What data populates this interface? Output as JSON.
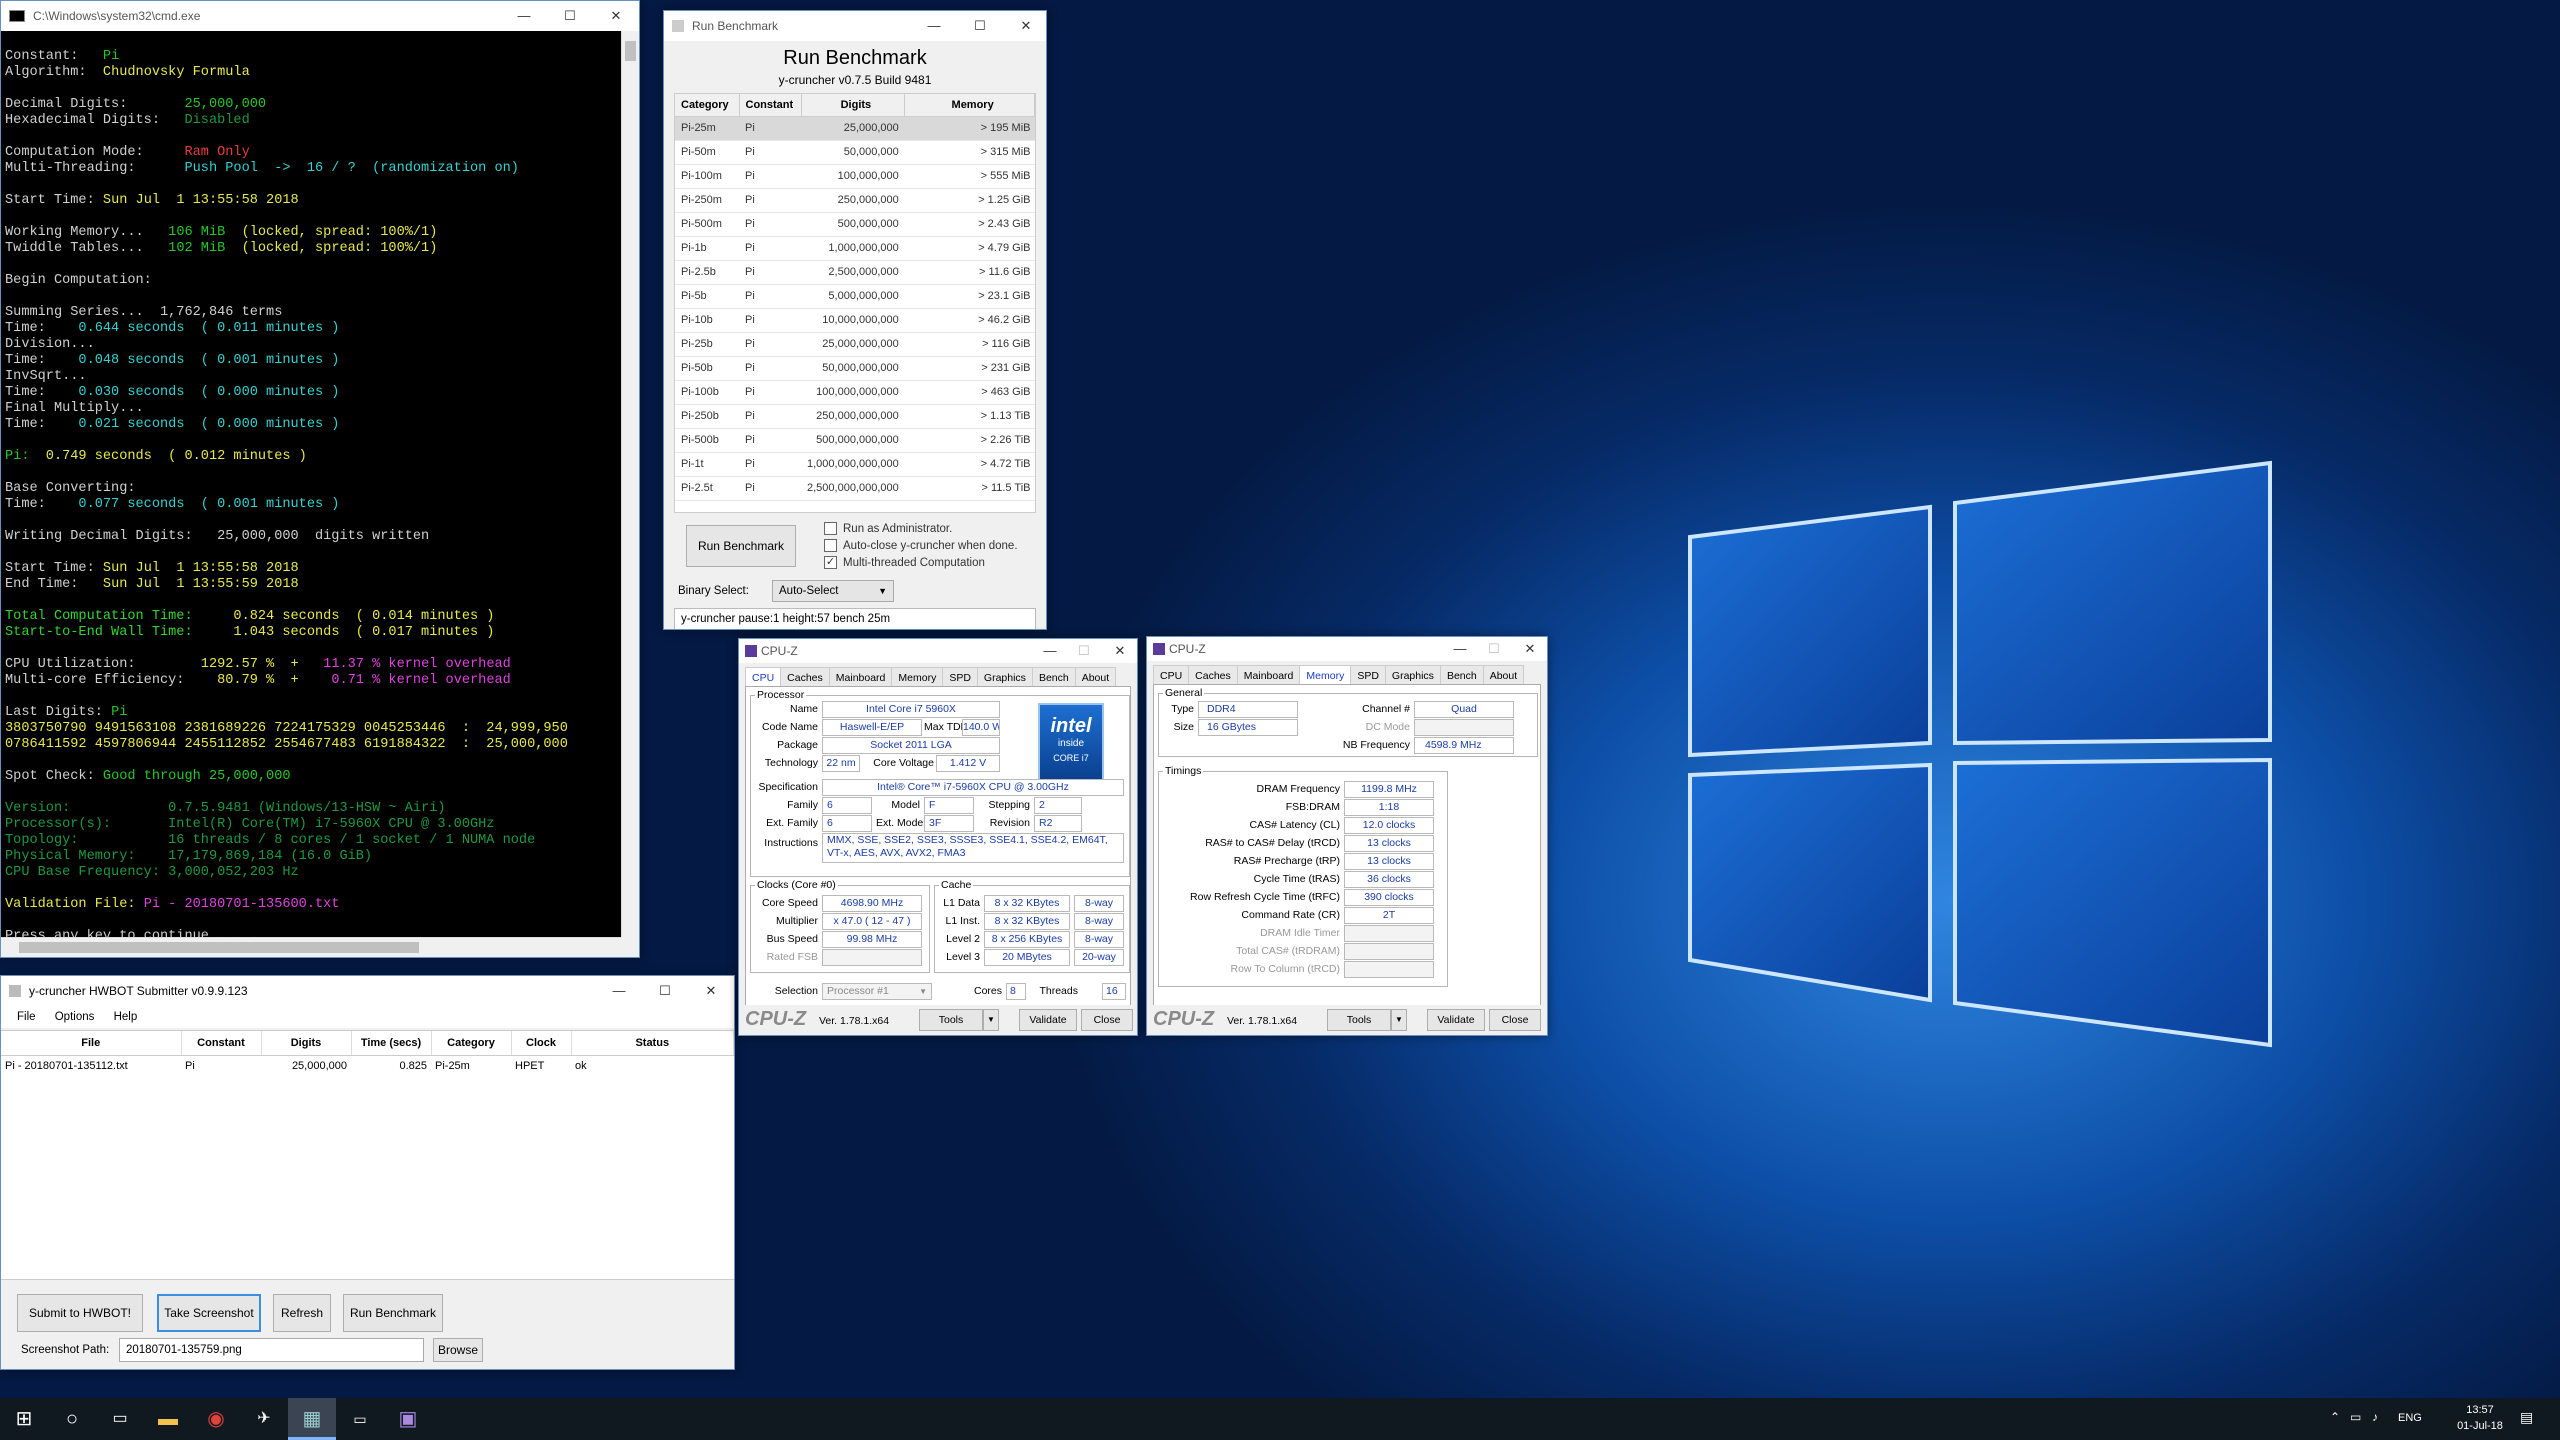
{
  "cmd": {
    "title": "C:\\Windows\\system32\\cmd.exe",
    "lines": [
      [
        [
          "",
          ""
        ]
      ],
      [
        [
          "w",
          "Constant:   "
        ],
        [
          "g",
          "Pi"
        ]
      ],
      [
        [
          "w",
          "Algorithm:  "
        ],
        [
          "y",
          "Chudnovsky Formula"
        ]
      ],
      [
        [
          "",
          ""
        ]
      ],
      [
        [
          "w",
          "Decimal Digits:       "
        ],
        [
          "g",
          "25,000,000"
        ]
      ],
      [
        [
          "w",
          "Hexadecimal Digits:   "
        ],
        [
          "dg",
          "Disabled"
        ]
      ],
      [
        [
          "",
          ""
        ]
      ],
      [
        [
          "w",
          "Computation Mode:     "
        ],
        [
          "r",
          "Ram Only"
        ]
      ],
      [
        [
          "w",
          "Multi-Threading:      "
        ],
        [
          "c",
          "Push Pool  ->  16 / ?  (randomization on)"
        ]
      ],
      [
        [
          "",
          ""
        ]
      ],
      [
        [
          "w",
          "Start Time: "
        ],
        [
          "y",
          "Sun Jul  1 13:55:58 2018"
        ]
      ],
      [
        [
          "",
          ""
        ]
      ],
      [
        [
          "w",
          "Working Memory...   "
        ],
        [
          "g",
          "106 MiB"
        ],
        [
          "y",
          "  (locked, spread: 100%/1)"
        ]
      ],
      [
        [
          "w",
          "Twiddle Tables...   "
        ],
        [
          "g",
          "102 MiB"
        ],
        [
          "y",
          "  (locked, spread: 100%/1)"
        ]
      ],
      [
        [
          "",
          ""
        ]
      ],
      [
        [
          "w",
          "Begin Computation:"
        ]
      ],
      [
        [
          "",
          ""
        ]
      ],
      [
        [
          "w",
          "Summing Series...  1,762,846 terms"
        ]
      ],
      [
        [
          "w",
          "Time:    "
        ],
        [
          "c",
          "0.644 seconds  ( 0.011 minutes )"
        ]
      ],
      [
        [
          "w",
          "Division..."
        ]
      ],
      [
        [
          "w",
          "Time:    "
        ],
        [
          "c",
          "0.048 seconds  ( 0.001 minutes )"
        ]
      ],
      [
        [
          "w",
          "InvSqrt..."
        ]
      ],
      [
        [
          "w",
          "Time:    "
        ],
        [
          "c",
          "0.030 seconds  ( 0.000 minutes )"
        ]
      ],
      [
        [
          "w",
          "Final Multiply..."
        ]
      ],
      [
        [
          "w",
          "Time:    "
        ],
        [
          "c",
          "0.021 seconds  ( 0.000 minutes )"
        ]
      ],
      [
        [
          "",
          ""
        ]
      ],
      [
        [
          "g",
          "Pi:  "
        ],
        [
          "y",
          "0.749 seconds  ( 0.012 minutes )"
        ]
      ],
      [
        [
          "",
          ""
        ]
      ],
      [
        [
          "w",
          "Base Converting:"
        ]
      ],
      [
        [
          "w",
          "Time:    "
        ],
        [
          "c",
          "0.077 seconds  ( 0.001 minutes )"
        ]
      ],
      [
        [
          "",
          ""
        ]
      ],
      [
        [
          "w",
          "Writing Decimal Digits:   25,000,000  digits written"
        ]
      ],
      [
        [
          "",
          ""
        ]
      ],
      [
        [
          "w",
          "Start Time: "
        ],
        [
          "y",
          "Sun Jul  1 13:55:58 2018"
        ]
      ],
      [
        [
          "w",
          "End Time:   "
        ],
        [
          "y",
          "Sun Jul  1 13:55:59 2018"
        ]
      ],
      [
        [
          "",
          ""
        ]
      ],
      [
        [
          "gr",
          "Total Computation Time:     "
        ],
        [
          "y",
          "0.824 seconds  ( 0.014 minutes )"
        ]
      ],
      [
        [
          "gr",
          "Start-to-End Wall Time:     "
        ],
        [
          "y",
          "1.043 seconds  ( 0.017 minutes )"
        ]
      ],
      [
        [
          "",
          ""
        ]
      ],
      [
        [
          "w",
          "CPU Utilization:        "
        ],
        [
          "y",
          "1292.57 %  +   "
        ],
        [
          "m",
          "11.37 % kernel overhead"
        ]
      ],
      [
        [
          "w",
          "Multi-core Efficiency:    "
        ],
        [
          "y",
          "80.79 %  +    "
        ],
        [
          "m",
          "0.71 % kernel overhead"
        ]
      ],
      [
        [
          "",
          ""
        ]
      ],
      [
        [
          "w",
          "Last Digits: "
        ],
        [
          "g",
          "Pi"
        ]
      ],
      [
        [
          "y",
          "3803750790 9491563108 2381689226 7224175329 0045253446  :  24,999,950"
        ]
      ],
      [
        [
          "y",
          "0786411592 4597806944 2455112852 2554677483 6191884322  :  25,000,000"
        ]
      ],
      [
        [
          "",
          ""
        ]
      ],
      [
        [
          "w",
          "Spot Check: "
        ],
        [
          "g",
          "Good through 25,000,000"
        ]
      ],
      [
        [
          "",
          ""
        ]
      ],
      [
        [
          "dg",
          "Version:            0.7.5.9481 (Windows/13-HSW ~ Airi)"
        ]
      ],
      [
        [
          "dg",
          "Processor(s):       Intel(R) Core(TM) i7-5960X CPU @ 3.00GHz"
        ]
      ],
      [
        [
          "dg",
          "Topology:           16 threads / 8 cores / 1 socket / 1 NUMA node"
        ]
      ],
      [
        [
          "dg",
          "Physical Memory:    17,179,869,184 (16.0 GiB)"
        ]
      ],
      [
        [
          "dg",
          "CPU Base Frequency: 3,000,052,203 Hz"
        ]
      ],
      [
        [
          "",
          ""
        ]
      ],
      [
        [
          "y",
          "Validation File: "
        ],
        [
          "m",
          "Pi - 20180701-135600.txt"
        ]
      ],
      [
        [
          "",
          ""
        ]
      ],
      [
        [
          "w",
          "Press any key to continue . . ."
        ]
      ]
    ]
  },
  "bench": {
    "title": "Run Benchmark",
    "heading": "Run Benchmark",
    "subheading": "y-cruncher v0.7.5 Build 9481",
    "columns": [
      "Category",
      "Constant",
      "Digits",
      "Memory"
    ],
    "rows": [
      [
        "Pi-25m",
        "Pi",
        "25,000,000",
        "> 195 MiB"
      ],
      [
        "Pi-50m",
        "Pi",
        "50,000,000",
        "> 315 MiB"
      ],
      [
        "Pi-100m",
        "Pi",
        "100,000,000",
        "> 555 MiB"
      ],
      [
        "Pi-250m",
        "Pi",
        "250,000,000",
        "> 1.25 GiB"
      ],
      [
        "Pi-500m",
        "Pi",
        "500,000,000",
        "> 2.43 GiB"
      ],
      [
        "Pi-1b",
        "Pi",
        "1,000,000,000",
        "> 4.79 GiB"
      ],
      [
        "Pi-2.5b",
        "Pi",
        "2,500,000,000",
        "> 11.6 GiB"
      ],
      [
        "Pi-5b",
        "Pi",
        "5,000,000,000",
        "> 23.1 GiB"
      ],
      [
        "Pi-10b",
        "Pi",
        "10,000,000,000",
        "> 46.2 GiB"
      ],
      [
        "Pi-25b",
        "Pi",
        "25,000,000,000",
        "> 116 GiB"
      ],
      [
        "Pi-50b",
        "Pi",
        "50,000,000,000",
        "> 231 GiB"
      ],
      [
        "Pi-100b",
        "Pi",
        "100,000,000,000",
        "> 463 GiB"
      ],
      [
        "Pi-250b",
        "Pi",
        "250,000,000,000",
        "> 1.13 TiB"
      ],
      [
        "Pi-500b",
        "Pi",
        "500,000,000,000",
        "> 2.26 TiB"
      ],
      [
        "Pi-1t",
        "Pi",
        "1,000,000,000,000",
        "> 4.72 TiB"
      ],
      [
        "Pi-2.5t",
        "Pi",
        "2,500,000,000,000",
        "> 11.5 TiB"
      ]
    ],
    "run_button": "Run Benchmark",
    "opt_admin": "Run as Administrator.",
    "opt_autoclose": "Auto-close y-cruncher when done.",
    "opt_mt": "Multi-threaded Computation",
    "binary_label": "Binary Select:",
    "binary_value": "Auto-Select",
    "command": "y-cruncher pause:1 height:57 bench 25m"
  },
  "hwbot": {
    "title": "y-cruncher HWBOT Submitter v0.9.9.123",
    "menu": [
      "File",
      "Options",
      "Help"
    ],
    "columns": [
      "File",
      "Constant",
      "Digits",
      "Time (secs)",
      "Category",
      "Clock",
      "Status"
    ],
    "rows": [
      [
        "Pi - 20180701-135112.txt",
        "Pi",
        "25,000,000",
        "0.825",
        "Pi-25m",
        "HPET",
        "ok"
      ]
    ],
    "btn_submit": "Submit to HWBOT!",
    "btn_screenshot": "Take Screenshot",
    "btn_refresh": "Refresh",
    "btn_run": "Run Benchmark",
    "path_label": "Screenshot Path:",
    "path_value": "20180701-135759.png",
    "btn_browse": "Browse"
  },
  "cpuz1": {
    "title": "CPU-Z",
    "tabs": [
      "CPU",
      "Caches",
      "Mainboard",
      "Memory",
      "SPD",
      "Graphics",
      "Bench",
      "About"
    ],
    "processor_legend": "Processor",
    "name_l": "Name",
    "name": "Intel Core i7 5960X",
    "codename_l": "Code Name",
    "codename": "Haswell-E/EP",
    "maxtdp_l": "Max TDP",
    "maxtdp": "140.0 W",
    "package_l": "Package",
    "package": "Socket 2011 LGA",
    "tech_l": "Technology",
    "tech": "22 nm",
    "voltage_l": "Core Voltage",
    "voltage": "1.412 V",
    "spec_l": "Specification",
    "spec": "Intel® Core™ i7-5960X CPU @ 3.00GHz",
    "family_l": "Family",
    "family": "6",
    "model_l": "Model",
    "model": "F",
    "stepping_l": "Stepping",
    "stepping": "2",
    "extfamily_l": "Ext. Family",
    "extfamily": "6",
    "extmodel_l": "Ext. Model",
    "extmodel": "3F",
    "revision_l": "Revision",
    "revision": "R2",
    "instr_l": "Instructions",
    "instr": "MMX, SSE, SSE2, SSE3, SSSE3, SSE4.1, SSE4.2, EM64T, VT-x, AES, AVX, AVX2, FMA3",
    "clocks_legend": "Clocks (Core #0)",
    "corespeed_l": "Core Speed",
    "corespeed": "4698.90 MHz",
    "mult_l": "Multiplier",
    "mult": "x 47.0 ( 12 - 47 )",
    "bus_l": "Bus Speed",
    "bus": "99.98 MHz",
    "ratedfsb_l": "Rated FSB",
    "ratedfsb": "",
    "cache_legend": "Cache",
    "l1d_l": "L1 Data",
    "l1d": "8 x 32 KBytes",
    "l1d_w": "8-way",
    "l1i_l": "L1 Inst.",
    "l1i": "8 x 32 KBytes",
    "l1i_w": "8-way",
    "l2_l": "Level 2",
    "l2": "8 x 256 KBytes",
    "l2_w": "8-way",
    "l3_l": "Level 3",
    "l3": "20 MBytes",
    "l3_w": "20-way",
    "selection_l": "Selection",
    "selection": "Processor #1",
    "cores_l": "Cores",
    "cores": "8",
    "threads_l": "Threads",
    "threads": "16",
    "logo": "CPU-Z",
    "version": "Ver. 1.78.1.x64",
    "tools": "Tools",
    "validate": "Validate",
    "close": "Close",
    "intel_line1": "intel",
    "intel_line2": "inside",
    "intel_line3": "CORE i7"
  },
  "cpuz2": {
    "title": "CPU-Z",
    "tabs": [
      "CPU",
      "Caches",
      "Mainboard",
      "Memory",
      "SPD",
      "Graphics",
      "Bench",
      "About"
    ],
    "general_legend": "General",
    "type_l": "Type",
    "type": "DDR4",
    "channel_l": "Channel #",
    "channel": "Quad",
    "size_l": "Size",
    "size": "16 GBytes",
    "dcmode_l": "DC Mode",
    "dcmode": "",
    "nbfreq_l": "NB Frequency",
    "nbfreq": "4598.9 MHz",
    "timings_legend": "Timings",
    "timings": [
      [
        "DRAM Frequency",
        "1199.8 MHz"
      ],
      [
        "FSB:DRAM",
        "1:18"
      ],
      [
        "CAS# Latency (CL)",
        "12.0 clocks"
      ],
      [
        "RAS# to CAS# Delay (tRCD)",
        "13 clocks"
      ],
      [
        "RAS# Precharge (tRP)",
        "13 clocks"
      ],
      [
        "Cycle Time (tRAS)",
        "36 clocks"
      ],
      [
        "Row Refresh Cycle Time (tRFC)",
        "390 clocks"
      ],
      [
        "Command Rate (CR)",
        "2T"
      ],
      [
        "DRAM Idle Timer",
        ""
      ],
      [
        "Total CAS# (tRDRAM)",
        ""
      ],
      [
        "Row To Column (tRCD)",
        ""
      ]
    ],
    "logo": "CPU-Z",
    "version": "Ver. 1.78.1.x64",
    "tools": "Tools",
    "validate": "Validate",
    "close": "Close"
  },
  "taskbar": {
    "lang": "ENG",
    "time": "13:57",
    "date": "01-Jul-18"
  },
  "colors": {
    "accent": "#0078d7",
    "cmd_bg": "#000000",
    "cpuz_value": "#1a3ca8"
  }
}
